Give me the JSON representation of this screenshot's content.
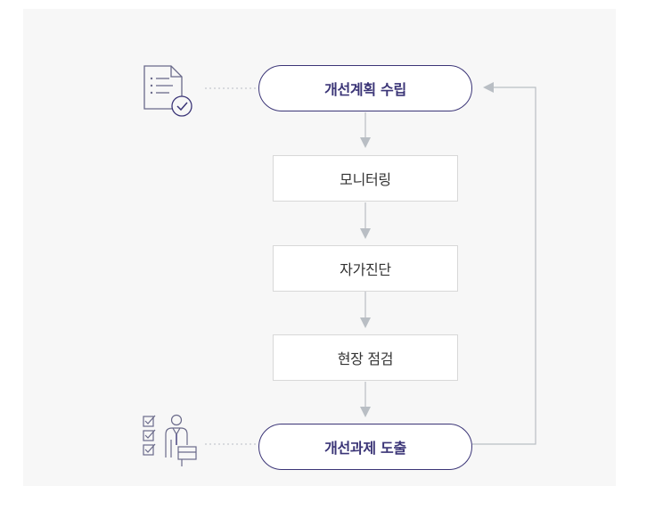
{
  "diagram": {
    "steps": {
      "plan": "개선계획 수립",
      "monitoring": "모니터링",
      "self_diagnosis": "자가진단",
      "field_inspection": "현장 점검",
      "derive_tasks": "개선과제 도출"
    },
    "icons": {
      "plan_icon": "document-checklist-icon",
      "tasks_icon": "checklist-person-icon"
    },
    "colors": {
      "background": "#f7f7f7",
      "accent": "#3b3577",
      "arrow": "#b9bec4",
      "box_border": "#d8d8d8",
      "text": "#333333"
    }
  }
}
